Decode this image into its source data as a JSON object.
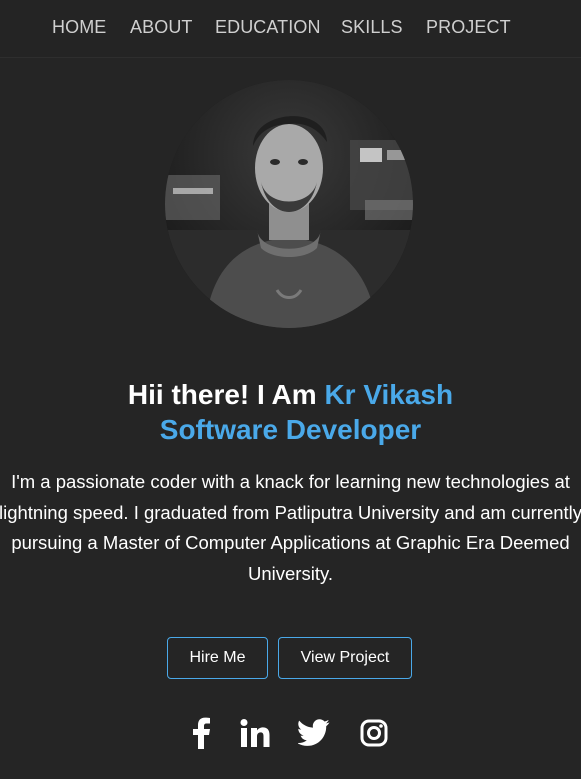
{
  "nav": {
    "items": [
      "HOME",
      "ABOUT",
      "EDUCATION",
      "SKILLS",
      "PROJECT"
    ]
  },
  "hero": {
    "greeting": "Hii there! I Am ",
    "name": "Kr Vikash",
    "role": "Software Developer",
    "bio": "I'm a passionate coder with a knack for learning new technologies at lightning speed. I graduated from Patliputra University and am currently pursuing a Master of Computer Applications at Graphic Era Deemed University."
  },
  "buttons": {
    "hire": "Hire Me",
    "project": "View Project"
  },
  "social": [
    "facebook-icon",
    "linkedin-icon",
    "twitter-icon",
    "instagram-icon"
  ],
  "colors": {
    "background": "#252525",
    "accent": "#4aa9e9",
    "nav_text": "#cfcfcf"
  }
}
